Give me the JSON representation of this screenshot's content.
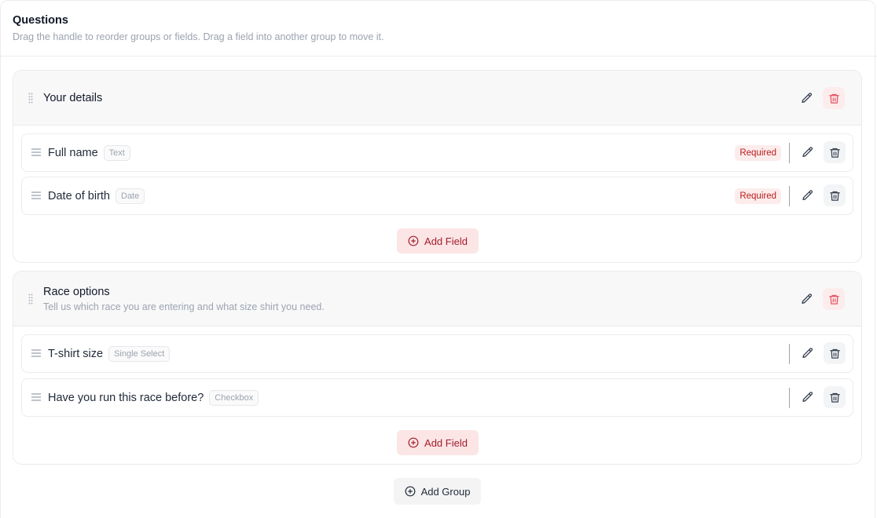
{
  "header": {
    "title": "Questions",
    "subtitle": "Drag the handle to reorder groups or fields. Drag a field into another group to move it."
  },
  "colors": {
    "accent": "#a31d2c",
    "accent_bg": "#fbe5e5",
    "danger": "#e11d48",
    "muted": "#9ca3af"
  },
  "groups": [
    {
      "title": "Your details",
      "description": "",
      "fields": [
        {
          "label": "Full name",
          "type": "Text",
          "required_label": "Required"
        },
        {
          "label": "Date of birth",
          "type": "Date",
          "required_label": "Required"
        }
      ],
      "add_field_label": "Add Field"
    },
    {
      "title": "Race options",
      "description": "Tell us which race you are entering and what size shirt you need.",
      "fields": [
        {
          "label": "T-shirt size",
          "type": "Single Select",
          "required_label": ""
        },
        {
          "label": "Have you run this race before?",
          "type": "Checkbox",
          "required_label": ""
        }
      ],
      "add_field_label": "Add Field"
    }
  ],
  "add_group_label": "Add Group",
  "icons": {
    "group_handle": "grip-dots-icon",
    "field_handle": "drag-lines-icon",
    "edit": "pencil-icon",
    "delete": "trash-icon",
    "add": "plus-circle-icon"
  }
}
